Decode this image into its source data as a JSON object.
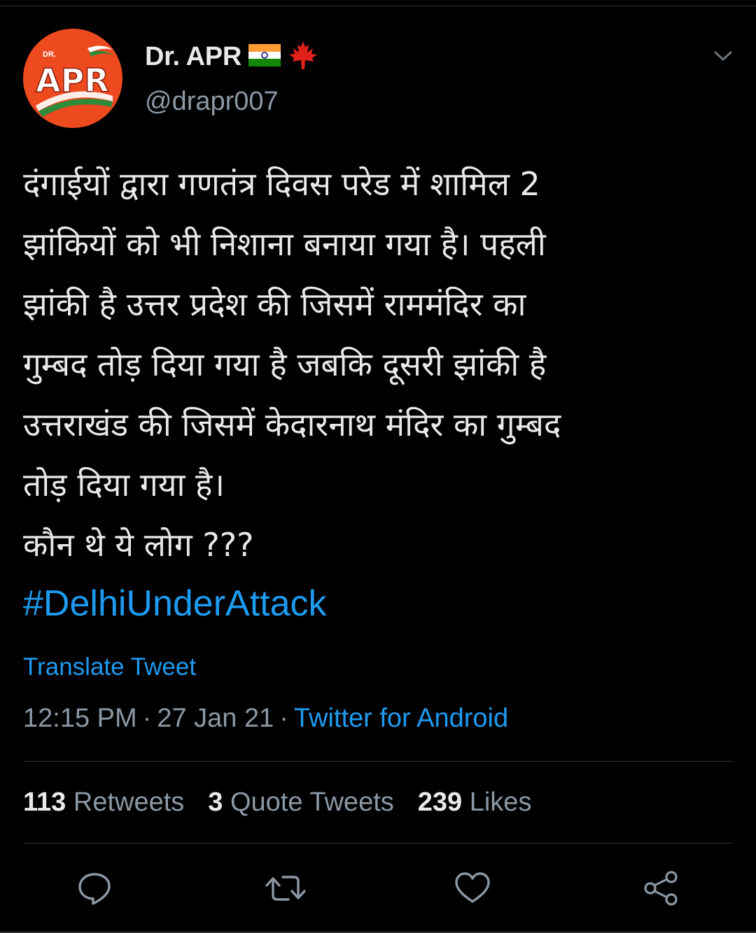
{
  "colors": {
    "background": "#000000",
    "text": "#e7e9ea",
    "secondary": "#8b98a5",
    "link": "#1d9bf0",
    "divider": "#2f3336",
    "avatar_bg": "#ee4a1f"
  },
  "author": {
    "display_name": "Dr. APR",
    "handle": "@drapr007",
    "avatar_logo": "APR",
    "avatar_small": "DR.",
    "badges": [
      "india-flag-icon",
      "maple-leaf-icon"
    ]
  },
  "tweet": {
    "lines": [
      "दंगाईयों द्वारा गणतंत्र दिवस परेड में शामिल 2",
      "झांकियों को भी निशाना बनाया गया है। पहली",
      "झांकी है उत्तर प्रदेश की जिसमें राममंदिर का",
      "गुम्बद तोड़ दिया गया है जबकि दूसरी झांकी है",
      "उत्तराखंड की जिसमें केदारनाथ मंदिर का गुम्बद",
      "तोड़ दिया गया है।",
      "कौन थे ये लोग ???"
    ],
    "hashtag": "#DelhiUnderAttack",
    "translate_label": "Translate Tweet",
    "time": "12:15 PM",
    "date": "27 Jan 21",
    "separator": "·",
    "source": "Twitter for Android"
  },
  "stats": {
    "retweets_count": "113",
    "retweets_label": "Retweets",
    "quotes_count": "3",
    "quotes_label": "Quote Tweets",
    "likes_count": "239",
    "likes_label": "Likes"
  },
  "actions": [
    "reply-icon",
    "retweet-icon",
    "like-icon",
    "share-icon"
  ]
}
